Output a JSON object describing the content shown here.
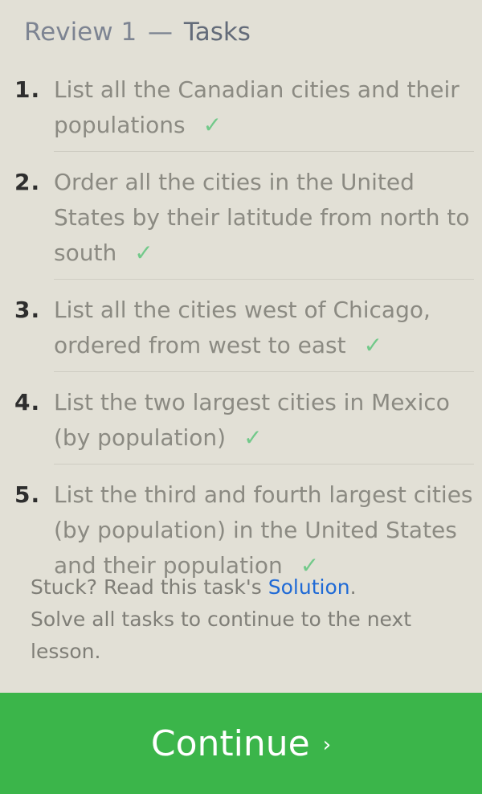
{
  "header": {
    "review": "Review 1",
    "separator": "—",
    "title": "Tasks"
  },
  "tasks": [
    {
      "number": "1.",
      "text": "List all the Canadian cities and their populations",
      "check": "✓"
    },
    {
      "number": "2.",
      "text": "Order all the cities in the United States by their latitude from north to south",
      "check": "✓"
    },
    {
      "number": "3.",
      "text": "List all the cities west of Chicago, ordered from west to east",
      "check": "✓"
    },
    {
      "number": "4.",
      "text": "List the two largest cities in Mexico (by population)",
      "check": "✓"
    },
    {
      "number": "5.",
      "text": "List the third and fourth largest cities (by population) in the United States and their population",
      "check": "✓"
    }
  ],
  "footer": {
    "stuck_prefix": "Stuck? Read this task's ",
    "solution_link": "Solution",
    "stuck_suffix": ".",
    "continue_note": "Solve all tasks to continue to the next lesson."
  },
  "continue_button": {
    "label": "Continue",
    "chevron": "›"
  },
  "colors": {
    "background": "#e2e0d6",
    "check": "#72c98a",
    "link": "#1f6ad6",
    "button": "#3bb54a"
  }
}
